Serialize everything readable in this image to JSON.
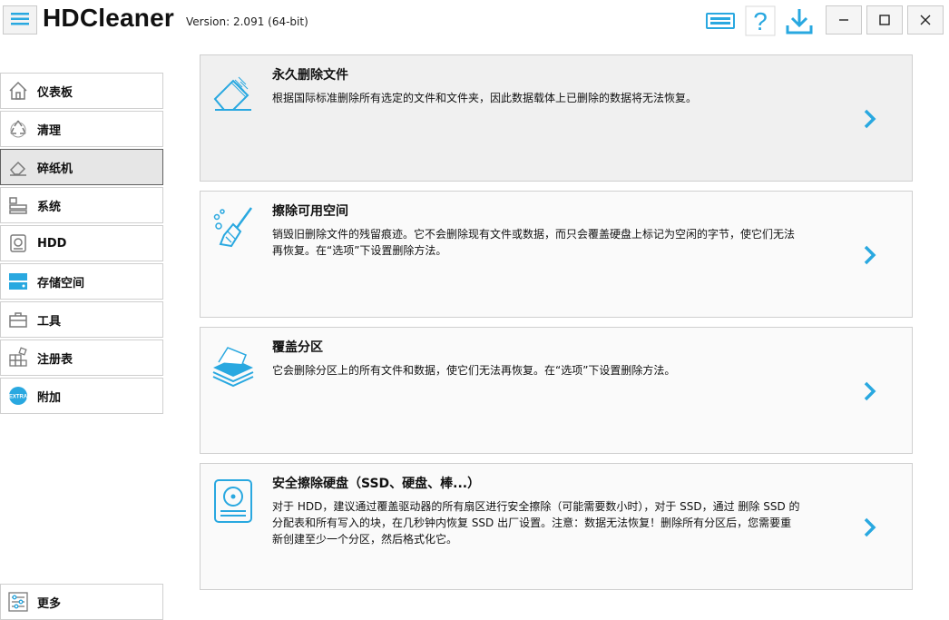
{
  "app": {
    "title": "HDCleaner",
    "version": "Version: 2.091 (64-bit)"
  },
  "toolbar": {
    "icons": [
      "hardware-info-icon",
      "help-icon",
      "download-icon"
    ],
    "window_controls": {
      "minimize": "—",
      "maximize": "☐",
      "close": "✕"
    }
  },
  "sidebar": {
    "items": [
      {
        "label": "仪表板",
        "icon": "home-icon",
        "active": false
      },
      {
        "label": "清理",
        "icon": "recycle-icon",
        "active": false
      },
      {
        "label": "碎纸机",
        "icon": "eraser-icon",
        "active": true
      },
      {
        "label": "系统",
        "icon": "system-icon",
        "active": false
      },
      {
        "label": "HDD",
        "icon": "hdd-icon",
        "active": false
      },
      {
        "label": "存储空间",
        "icon": "storage-icon",
        "active": false
      },
      {
        "label": "工具",
        "icon": "toolbox-icon",
        "active": false
      },
      {
        "label": "注册表",
        "icon": "registry-icon",
        "active": false
      },
      {
        "label": "附加",
        "icon": "extra-icon",
        "active": false
      }
    ],
    "more": {
      "label": "更多",
      "icon": "settings-sliders-icon"
    }
  },
  "cards": [
    {
      "title": "永久删除文件",
      "description": "根据国际标准删除所有选定的文件和文件夹，因此数据载体上已删除的数据将无法恢复。",
      "icon": "eraser-icon"
    },
    {
      "title": "擦除可用空间",
      "description": "销毁旧删除文件的残留痕迹。它不会删除现有文件或数据，而只会覆盖硬盘上标记为空闲的字节，使它们无法再恢复。在“选项”下设置删除方法。",
      "icon": "broom-icon"
    },
    {
      "title": "覆盖分区",
      "description": "它会删除分区上的所有文件和数据，使它们无法再恢复。在“选项”下设置删除方法。",
      "icon": "paper-stack-icon"
    },
    {
      "title": "安全擦除硬盘（SSD、硬盘、棒...）",
      "description": "对于 HDD，建议通过覆盖驱动器的所有扇区进行安全擦除（可能需要数小时），对于 SSD，通过 删除 SSD 的分配表和所有写入的块，在几秒钟内恢复 SSD 出厂设置。注意：数据无法恢复！删除所有分区后，您需要重新创建至少一个分区，然后格式化它。",
      "icon": "hard-drive-icon"
    }
  ],
  "colors": {
    "accent": "#29a8e0",
    "icon_gray": "#7a7a7a",
    "active_nav_bg": "#e6e6e6"
  }
}
